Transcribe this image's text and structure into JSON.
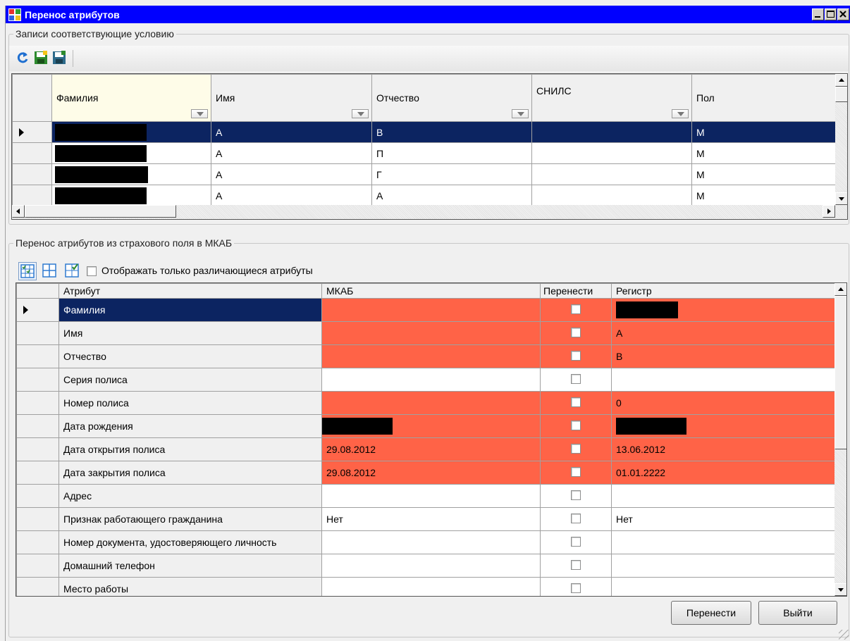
{
  "window": {
    "title": "Перенос атрибутов"
  },
  "top_group": {
    "legend": "Записи соответствующие условию",
    "toolbar": [
      "refresh-icon",
      "save-icon",
      "save-alt-icon"
    ],
    "columns": [
      "Фамилия",
      "Имя",
      "Отчество",
      "СНИЛС",
      "Пол"
    ],
    "rows": [
      {
        "surname": "",
        "name": "А",
        "patronymic": "В",
        "snils": "",
        "sex": "М",
        "selected": true
      },
      {
        "surname": "",
        "name": "А",
        "patronymic": "П",
        "snils": "",
        "sex": "М",
        "selected": false
      },
      {
        "surname": "",
        "name": "А",
        "patronymic": "Г",
        "snils": "",
        "sex": "М",
        "selected": false
      },
      {
        "surname": "",
        "name": "А",
        "patronymic": "А",
        "snils": "",
        "sex": "М",
        "selected": false
      }
    ]
  },
  "bottom_group": {
    "legend": "Перенос атрибутов из страхового поля в МКАБ",
    "toolbar": [
      "grid-check-icon",
      "grid-icon",
      "grid-checked-icon"
    ],
    "only_diff_label": "Отображать только различающиеся атрибуты",
    "columns": [
      "Атрибут",
      "МКАБ",
      "Перенести",
      "Регистр"
    ],
    "rows": [
      {
        "attr": "Фамилия",
        "mkab": "",
        "register": "",
        "diff": true,
        "selected": true
      },
      {
        "attr": "Имя",
        "mkab": "",
        "register": "А",
        "diff": true
      },
      {
        "attr": "Отчество",
        "mkab": "",
        "register": "В",
        "diff": true
      },
      {
        "attr": "Серия полиса",
        "mkab": "",
        "register": "",
        "diff": false
      },
      {
        "attr": "Номер полиса",
        "mkab": "",
        "register": "0",
        "diff": true
      },
      {
        "attr": "Дата рождения",
        "mkab": "",
        "register": "",
        "diff": true
      },
      {
        "attr": "Дата открытия полиса",
        "mkab": "29.08.2012",
        "register": "13.06.2012",
        "diff": true
      },
      {
        "attr": "Дата закрытия полиса",
        "mkab": "29.08.2012",
        "register": "01.01.2222",
        "diff": true
      },
      {
        "attr": "Адрес",
        "mkab": "",
        "register": "",
        "diff": false
      },
      {
        "attr": "Признак работающего гражданина",
        "mkab": "Нет",
        "register": "Нет",
        "diff": false
      },
      {
        "attr": "Номер документа, удостоверяющего личность",
        "mkab": "",
        "register": "",
        "diff": false
      },
      {
        "attr": "Домашний телефон",
        "mkab": "",
        "register": "",
        "diff": false
      },
      {
        "attr": "Место работы",
        "mkab": "",
        "register": "",
        "diff": false
      }
    ]
  },
  "buttons": {
    "transfer": "Перенести",
    "exit": "Выйти"
  },
  "colors": {
    "title_bar": "#0000ff",
    "selection": "#0c2461",
    "diff_row": "#ff6347"
  }
}
